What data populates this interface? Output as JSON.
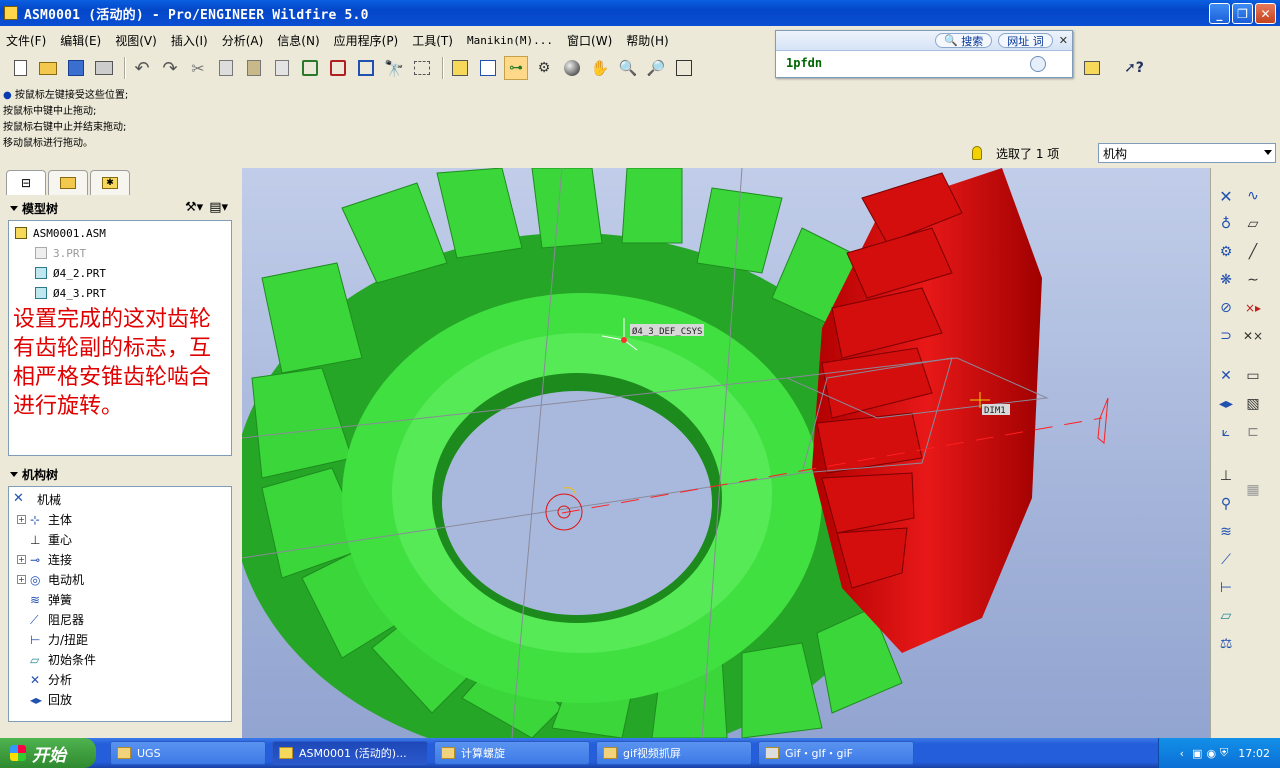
{
  "window": {
    "title": "ASM0001 (活动的) - Pro/ENGINEER Wildfire 5.0"
  },
  "menu": [
    "文件(F)",
    "编辑(E)",
    "视图(V)",
    "插入(I)",
    "分析(A)",
    "信息(N)",
    "应用程序(P)",
    "工具(T)",
    "Manikin(M)...",
    "窗口(W)",
    "帮助(H)"
  ],
  "search_popup": {
    "tab1": "搜索",
    "tab2": "网址",
    "tab3": "词",
    "value": "1pfdn"
  },
  "messages": [
    "按鼠标左键接受这些位置;",
    "按鼠标中键中止拖动;",
    "按鼠标右键中止并结束拖动;",
    "移动鼠标进行拖动。"
  ],
  "selection": {
    "text": "选取了 1 项",
    "filter": "机构"
  },
  "model_tree": {
    "header": "模型树",
    "items": [
      {
        "label": "ASM0001.ASM",
        "dim": false
      },
      {
        "label": "3.PRT",
        "dim": true
      },
      {
        "label": "Ø4_2.PRT",
        "dim": false
      },
      {
        "label": "Ø4_3.PRT",
        "dim": false
      }
    ]
  },
  "annotation": "设置完成的这对齿轮有齿轮副的标志，互相严格安锥齿轮啮合进行旋转。",
  "mech_tree": {
    "header": "机构树",
    "root": "机械",
    "items": [
      {
        "label": "主体",
        "expandable": true
      },
      {
        "label": "重心",
        "expandable": false
      },
      {
        "label": "连接",
        "expandable": true
      },
      {
        "label": "电动机",
        "expandable": true
      },
      {
        "label": "弹簧",
        "expandable": false
      },
      {
        "label": "阻尼器",
        "expandable": false
      },
      {
        "label": "力/扭距",
        "expandable": false
      },
      {
        "label": "初始条件",
        "expandable": false
      },
      {
        "label": "分析",
        "expandable": false
      },
      {
        "label": "回放",
        "expandable": false
      }
    ]
  },
  "viewport": {
    "csys_label": "Ø4_3_DEF_CSYS",
    "dim_label": "DIM1",
    "gear_green": "#3fd23f",
    "gear_red": "#e01010"
  },
  "taskbar": {
    "start": "开始",
    "items": [
      "UGS",
      "ASM0001 (活动的)...",
      "计算螺旋",
      "gif视频抓屏",
      "Gif・gIf・giF"
    ],
    "clock": "17:02"
  }
}
